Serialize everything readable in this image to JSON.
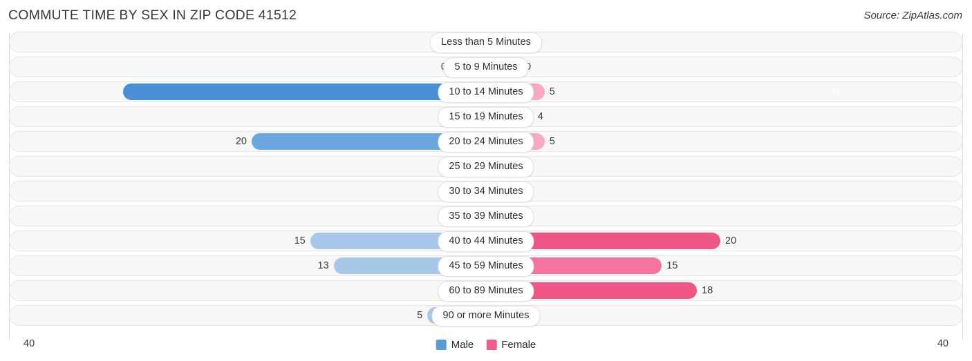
{
  "header": {
    "title": "COMMUTE TIME BY SEX IN ZIP CODE 41512",
    "source": "Source: ZipAtlas.com"
  },
  "axis": {
    "left_label": "40",
    "right_label": "40"
  },
  "legend": {
    "items": [
      {
        "label": "Male",
        "color": "#5b9bd5"
      },
      {
        "label": "Female",
        "color": "#ef5b8c"
      }
    ]
  },
  "colors": {
    "male_strong": "#4a90d9",
    "male_mid": "#6ca6de",
    "male_light": "#a8c8ea",
    "female_strong": "#ef5585",
    "female_mid": "#f4749f",
    "female_light": "#f7a8c4",
    "track": "#f7f7f7",
    "track_border": "#e6e6e6",
    "gridline": "#d9d9d9"
  },
  "chart_data": {
    "type": "bar",
    "title": "COMMUTE TIME BY SEX IN ZIP CODE 41512",
    "subtitle": "",
    "xlabel": "",
    "ylabel": "",
    "orientation": "horizontal",
    "layout": "diverging-bidirectional",
    "grid": false,
    "legend_position": "bottom-center",
    "axis_max": 40,
    "xlim": [
      40,
      40
    ],
    "categories": [
      "Less than 5 Minutes",
      "5 to 9 Minutes",
      "10 to 14 Minutes",
      "15 to 19 Minutes",
      "20 to 24 Minutes",
      "25 to 29 Minutes",
      "30 to 34 Minutes",
      "35 to 39 Minutes",
      "40 to 44 Minutes",
      "45 to 59 Minutes",
      "60 to 89 Minutes",
      "90 or more Minutes"
    ],
    "series": [
      {
        "name": "Male",
        "side": "left",
        "values": [
          0,
          0,
          31,
          0,
          20,
          0,
          0,
          0,
          15,
          13,
          0,
          5
        ]
      },
      {
        "name": "Female",
        "side": "right",
        "values": [
          0,
          0,
          5,
          4,
          5,
          0,
          0,
          0,
          20,
          15,
          18,
          0
        ]
      }
    ]
  },
  "rows": [
    {
      "label": "Less than 5 Minutes",
      "male": 0,
      "female": 0,
      "male_text": "0",
      "female_text": "0",
      "male_inside": false,
      "female_inside": false
    },
    {
      "label": "5 to 9 Minutes",
      "male": 0,
      "female": 0,
      "male_text": "0",
      "female_text": "0",
      "male_inside": false,
      "female_inside": false
    },
    {
      "label": "10 to 14 Minutes",
      "male": 31,
      "female": 5,
      "male_text": "31",
      "female_text": "5",
      "male_inside": true,
      "female_inside": false
    },
    {
      "label": "15 to 19 Minutes",
      "male": 0,
      "female": 4,
      "male_text": "0",
      "female_text": "4",
      "male_inside": false,
      "female_inside": false
    },
    {
      "label": "20 to 24 Minutes",
      "male": 20,
      "female": 5,
      "male_text": "20",
      "female_text": "5",
      "male_inside": false,
      "female_inside": false
    },
    {
      "label": "25 to 29 Minutes",
      "male": 0,
      "female": 0,
      "male_text": "0",
      "female_text": "0",
      "male_inside": false,
      "female_inside": false
    },
    {
      "label": "30 to 34 Minutes",
      "male": 0,
      "female": 0,
      "male_text": "0",
      "female_text": "0",
      "male_inside": false,
      "female_inside": false
    },
    {
      "label": "35 to 39 Minutes",
      "male": 0,
      "female": 0,
      "male_text": "0",
      "female_text": "0",
      "male_inside": false,
      "female_inside": false
    },
    {
      "label": "40 to 44 Minutes",
      "male": 15,
      "female": 20,
      "male_text": "15",
      "female_text": "20",
      "male_inside": false,
      "female_inside": false
    },
    {
      "label": "45 to 59 Minutes",
      "male": 13,
      "female": 15,
      "male_text": "13",
      "female_text": "15",
      "male_inside": false,
      "female_inside": false
    },
    {
      "label": "60 to 89 Minutes",
      "male": 0,
      "female": 18,
      "male_text": "0",
      "female_text": "18",
      "male_inside": false,
      "female_inside": false
    },
    {
      "label": "90 or more Minutes",
      "male": 5,
      "female": 0,
      "male_text": "5",
      "female_text": "0",
      "male_inside": false,
      "female_inside": false
    }
  ]
}
